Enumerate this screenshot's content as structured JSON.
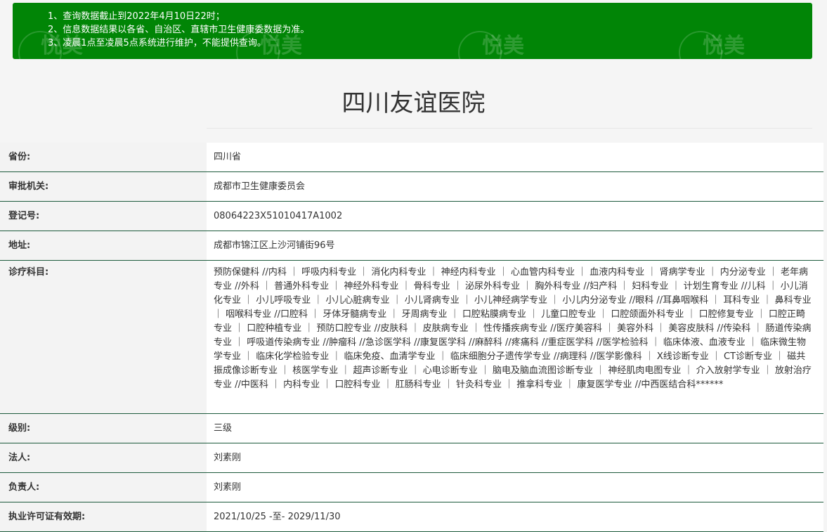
{
  "notice": {
    "lines": [
      "1、查询数据截止到2022年4月10日22时；",
      "2、信息数据结果以各省、自治区、直辖市卫生健康委数据为准。",
      "3、凌晨1点至凌晨5点系统进行维护，不能提供查询。"
    ],
    "watermark": "悦美",
    "background": "#018506"
  },
  "hospital": {
    "name": "四川友谊医院"
  },
  "info": {
    "province_label": "省份:",
    "province_value": "四川省",
    "authority_label": "审批机关:",
    "authority_value": "成都市卫生健康委员会",
    "registration_label": "登记号:",
    "registration_value": "08064223X51010417A1002",
    "address_label": "地址:",
    "address_value": "成都市锦江区上沙河铺街96号",
    "departments_label": "诊疗科目:",
    "departments_value": "预防保健科 //内科 ｜ 呼吸内科专业 ｜ 消化内科专业 ｜ 神经内科专业 ｜ 心血管内科专业 ｜ 血液内科专业 ｜ 肾病学专业 ｜ 内分泌专业 ｜ 老年病专业 //外科 ｜ 普通外科专业 ｜ 神经外科专业 ｜ 骨科专业 ｜ 泌尿外科专业 ｜ 胸外科专业 //妇产科 ｜ 妇科专业 ｜ 计划生育专业 //儿科 ｜ 小儿消化专业 ｜ 小儿呼吸专业 ｜ 小儿心脏病专业 ｜ 小儿肾病专业 ｜ 小儿神经病学专业 ｜ 小儿内分泌专业 //眼科 //耳鼻咽喉科 ｜ 耳科专业 ｜ 鼻科专业 ｜ 咽喉科专业 //口腔科 ｜ 牙体牙髓病专业 ｜ 牙周病专业 ｜ 口腔粘膜病专业 ｜ 儿童口腔专业 ｜ 口腔颌面外科专业 ｜ 口腔修复专业 ｜ 口腔正畸专业 ｜ 口腔种植专业 ｜ 预防口腔专业 //皮肤科 ｜ 皮肤病专业 ｜ 性传播疾病专业 //医疗美容科 ｜ 美容外科 ｜ 美容皮肤科 //传染科 ｜ 肠道传染病专业 ｜ 呼吸道传染病专业 //肿瘤科 //急诊医学科 //康复医学科 //麻醉科 //疼痛科 //重症医学科 //医学检验科 ｜ 临床体液、血液专业 ｜ 临床微生物学专业 ｜ 临床化学检验专业 ｜ 临床免疫、血清学专业 ｜ 临床细胞分子遗传学专业 //病理科 //医学影像科 ｜ X线诊断专业 ｜ CT诊断专业 ｜ 磁共振成像诊断专业 ｜ 核医学专业 ｜ 超声诊断专业 ｜ 心电诊断专业 ｜ 脑电及脑血流图诊断专业 ｜ 神经肌肉电图专业 ｜ 介入放射学专业 ｜ 放射治疗专业 //中医科 ｜ 内科专业 ｜ 口腔科专业 ｜ 肛肠科专业 ｜ 针灸科专业 ｜ 推拿科专业 ｜ 康复医学专业 //中西医结合科******",
    "level_label": "级别:",
    "level_value": "三级",
    "legal_label": "法人:",
    "legal_value": "刘素刚",
    "head_label": "负责人:",
    "head_value": "刘素刚",
    "license_label": "执业许可证有效期:",
    "license_value": "2021/10/25 -至- 2029/11/30"
  }
}
